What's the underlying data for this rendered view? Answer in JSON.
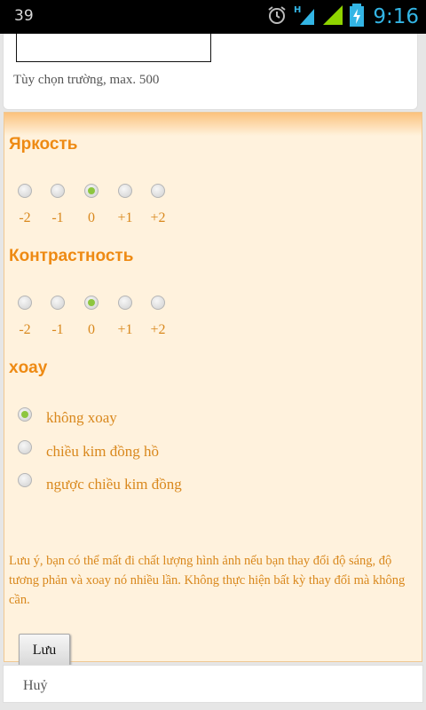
{
  "status_bar": {
    "notification_count": "39",
    "time": "9:16",
    "network_type": "H"
  },
  "form": {
    "text_field_value": "",
    "field_hint": "Tùy chọn trường, max. 500"
  },
  "brightness": {
    "title": "Яркость",
    "options": [
      "-2",
      "-1",
      "0",
      "+1",
      "+2"
    ],
    "selected": "0"
  },
  "contrast": {
    "title": "Контрастность",
    "options": [
      "-2",
      "-1",
      "0",
      "+1",
      "+2"
    ],
    "selected": "0"
  },
  "rotation": {
    "title": "xoay",
    "options": [
      "không xoay",
      "chiều kim đồng hồ",
      "ngược chiều kim đồng"
    ],
    "selected": "không xoay"
  },
  "note": "Lưu ý, bạn có thể mất đi chất lượng hình ảnh nếu bạn thay đổi độ sáng, độ tương phản và xoay nó nhiều lần. Không thực hiện bất kỳ thay đổi mà không cần.",
  "actions": {
    "save_label": "Lưu",
    "cancel_label": "Huỷ"
  },
  "colors": {
    "accent": "#ee8a13",
    "label_text": "#d9881d",
    "panel_bg": "#fff2dd",
    "radio_selected": "#8dc63f",
    "status_time": "#33b5e5"
  }
}
